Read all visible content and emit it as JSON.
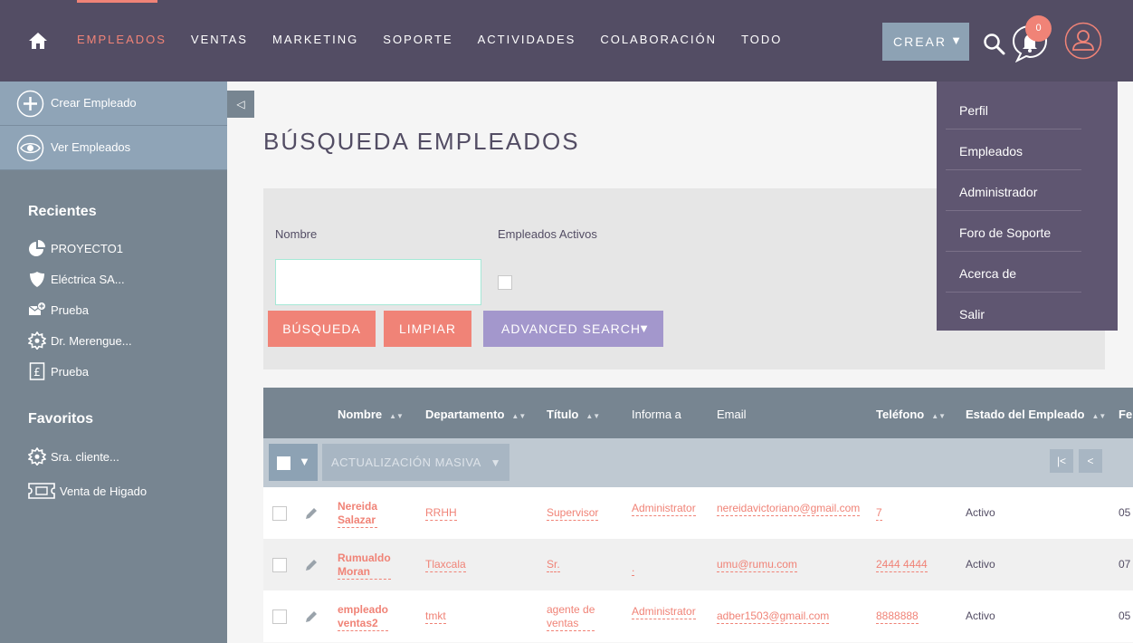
{
  "nav": {
    "items": [
      "EMPLEADOS",
      "VENTAS",
      "MARKETING",
      "SOPORTE",
      "ACTIVIDADES",
      "COLABORACIÓN",
      "TODO"
    ],
    "active": "EMPLEADOS",
    "create_label": "CREAR",
    "create_caret": "▼",
    "notification_count": "0"
  },
  "user_menu": {
    "items": [
      "Perfil",
      "Empleados",
      "Administrador",
      "Foro de Soporte",
      "Acerca de",
      "Salir"
    ]
  },
  "sidebar": {
    "actions": [
      "Crear Empleado",
      "Ver Empleados"
    ],
    "recientes_title": "Recientes",
    "recientes": [
      {
        "label": "PROYECTO1",
        "icon": "pie-chart-icon"
      },
      {
        "label": "Eléctrica SA...",
        "icon": "shield-icon"
      },
      {
        "label": "Prueba",
        "icon": "mail-plus-icon"
      },
      {
        "label": "Dr. Merengue...",
        "icon": "gear-badge-icon"
      },
      {
        "label": "Prueba",
        "icon": "pound-icon"
      }
    ],
    "favoritos_title": "Favoritos",
    "favoritos": [
      {
        "label": "Sra. cliente...",
        "icon": "gear-badge-icon"
      },
      {
        "label": "Venta de Higado",
        "icon": "ticket-icon"
      }
    ],
    "collapse_glyph": "◁"
  },
  "main": {
    "title": "BÚSQUEDA EMPLEADOS",
    "search": {
      "nombre_label": "Nombre",
      "nombre_value": "",
      "activos_label": "Empleados Activos",
      "btn_busqueda": "BÚSQUEDA",
      "btn_limpiar": "LIMPIAR",
      "btn_advanced": "ADVANCED SEARCH",
      "btn_advanced_caret": "▼"
    }
  },
  "table": {
    "columns": [
      "Nombre",
      "Departamento",
      "Título",
      "Informa a",
      "Email",
      "Teléfono",
      "Estado del Empleado",
      "Fe"
    ],
    "sort_glyph": "▲▼",
    "select_caret": "▼",
    "mass_update_label": "ACTUALIZACIÓN MASIVA",
    "mass_update_caret": "▼",
    "pager": {
      "first": "|<",
      "prev": "<"
    },
    "rows": [
      {
        "nombre": [
          "Nereida",
          "Salazar"
        ],
        "departamento": "RRHH",
        "titulo": [
          "Supervisor"
        ],
        "informa": "Administrator",
        "email": "nereidavictoriano@gmail.com",
        "telefono": "7",
        "estado": "Activo",
        "fecha": "05"
      },
      {
        "nombre": [
          "Rumualdo",
          "Moran"
        ],
        "departamento": "Tlaxcala",
        "titulo": [
          "Sr."
        ],
        "informa": ".",
        "email": "umu@rumu.com",
        "telefono": "2444 4444",
        "estado": "Activo",
        "fecha": "07"
      },
      {
        "nombre": [
          "empleado",
          "ventas2"
        ],
        "departamento": "tmkt",
        "titulo": [
          "agente de",
          "ventas"
        ],
        "informa": "Administrator",
        "email": "adber1503@gmail.com",
        "telefono": "8888888",
        "estado": "Activo",
        "fecha": "05"
      }
    ]
  },
  "colors": {
    "nav_bg": "#534d64",
    "accent": "#f08377",
    "sidebar_bg": "#778591",
    "advanced_btn": "#a397cc"
  }
}
